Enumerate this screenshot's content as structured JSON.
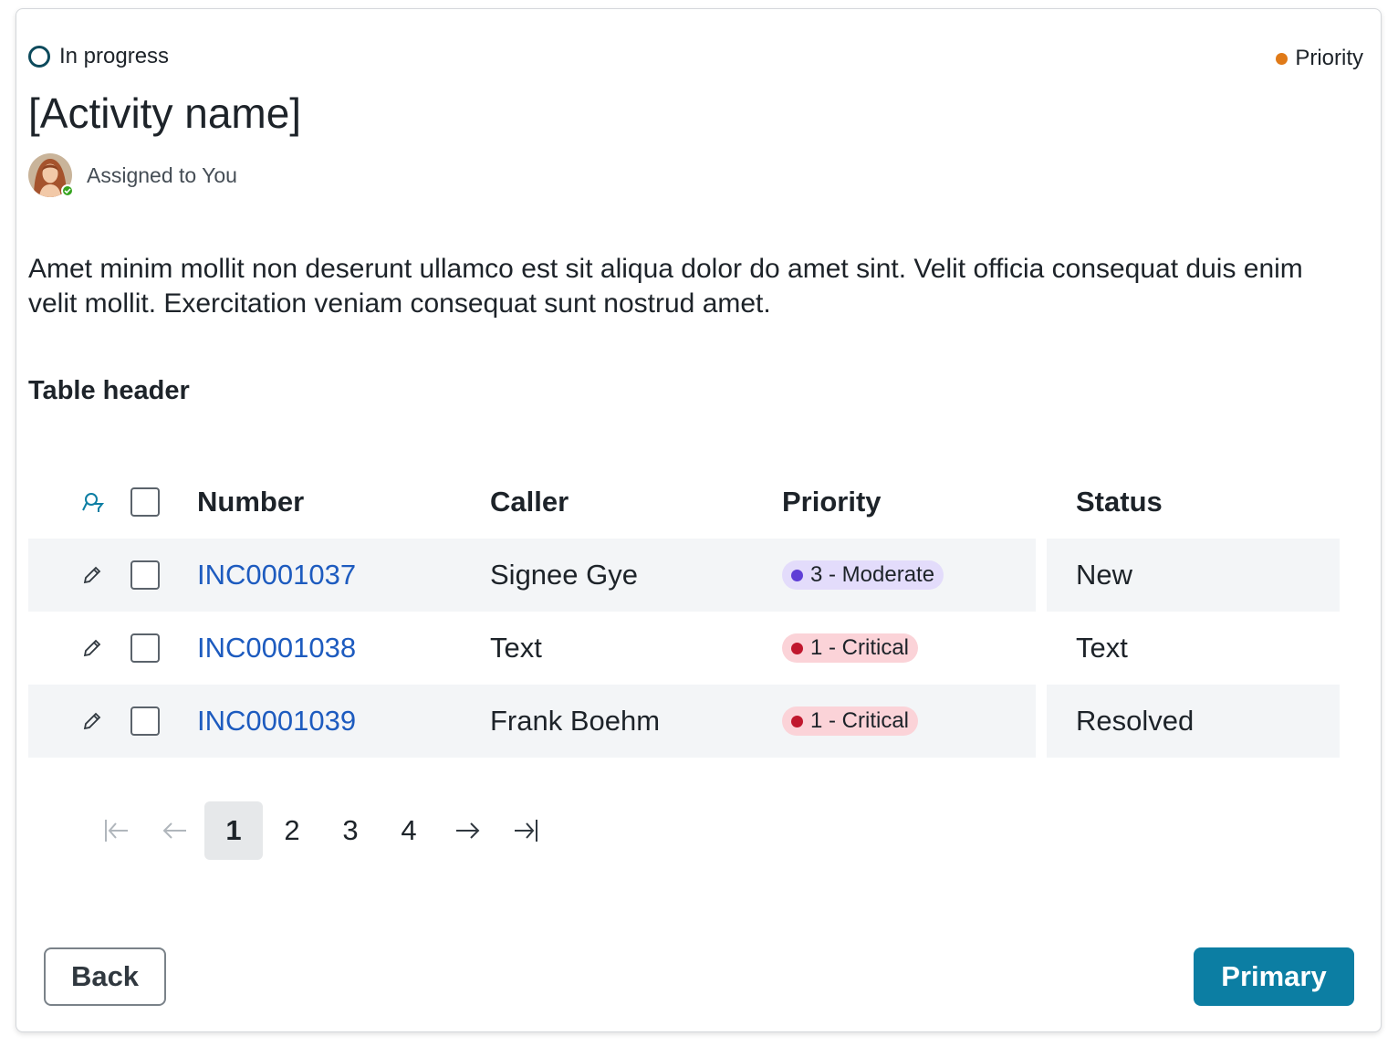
{
  "header": {
    "status_label": "In progress",
    "priority_label": "Priority",
    "priority_color": "#e07a18",
    "title": "[Activity name]",
    "assigned_label": "Assigned to You"
  },
  "description": "Amet minim mollit non deserunt ullamco est sit aliqua dolor do amet sint. Velit officia consequat duis enim velit mollit. Exercitation veniam consequat sunt nostrud amet.",
  "table": {
    "title": "Table header",
    "columns": [
      "Number",
      "Caller",
      "Priority",
      "Status"
    ],
    "rows": [
      {
        "number": "INC0001037",
        "caller": "Signee Gye",
        "priority": "3 - Moderate",
        "priority_level": "moderate",
        "status": "New"
      },
      {
        "number": "INC0001038",
        "caller": "Text",
        "priority": "1 - Critical",
        "priority_level": "critical",
        "status": "Text"
      },
      {
        "number": "INC0001039",
        "caller": "Frank Boehm",
        "priority": "1 - Critical",
        "priority_level": "critical",
        "status": "Resolved"
      }
    ]
  },
  "pagination": {
    "pages": [
      "1",
      "2",
      "3",
      "4"
    ],
    "current": "1"
  },
  "actions": {
    "back_label": "Back",
    "primary_label": "Primary"
  },
  "colors": {
    "accent": "#0c7ea3",
    "link": "#1d5bbf",
    "moderate_bg": "#e3dcfb",
    "moderate_dot": "#5f3fd6",
    "critical_bg": "#fbd3d8",
    "critical_dot": "#c0172d"
  }
}
